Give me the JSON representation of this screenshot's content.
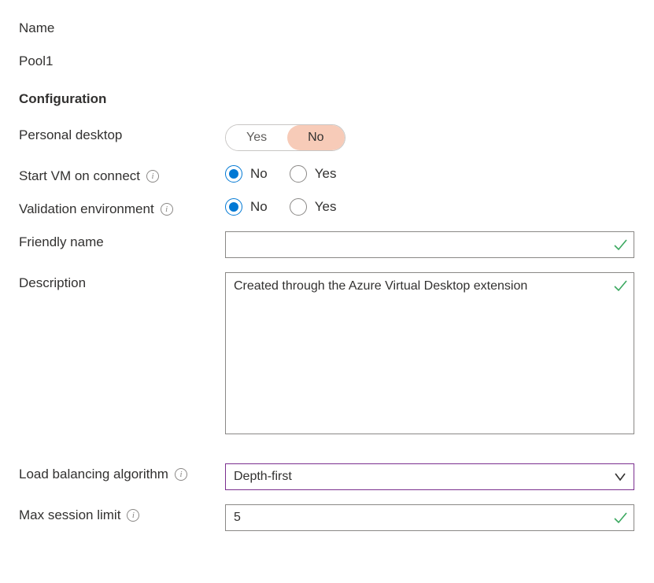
{
  "name_label": "Name",
  "name_value": "Pool1",
  "config_heading": "Configuration",
  "personal_desktop": {
    "label": "Personal desktop",
    "options": [
      "Yes",
      "No"
    ],
    "selected": "No"
  },
  "start_vm": {
    "label": "Start VM on connect",
    "options": [
      "No",
      "Yes"
    ],
    "selected": "No"
  },
  "validation_env": {
    "label": "Validation environment",
    "options": [
      "No",
      "Yes"
    ],
    "selected": "No"
  },
  "friendly_name": {
    "label": "Friendly name",
    "value": ""
  },
  "description": {
    "label": "Description",
    "value": "Created through the Azure Virtual Desktop extension"
  },
  "load_balancing": {
    "label": "Load balancing algorithm",
    "value": "Depth-first"
  },
  "max_session": {
    "label": "Max session limit",
    "value": "5"
  }
}
